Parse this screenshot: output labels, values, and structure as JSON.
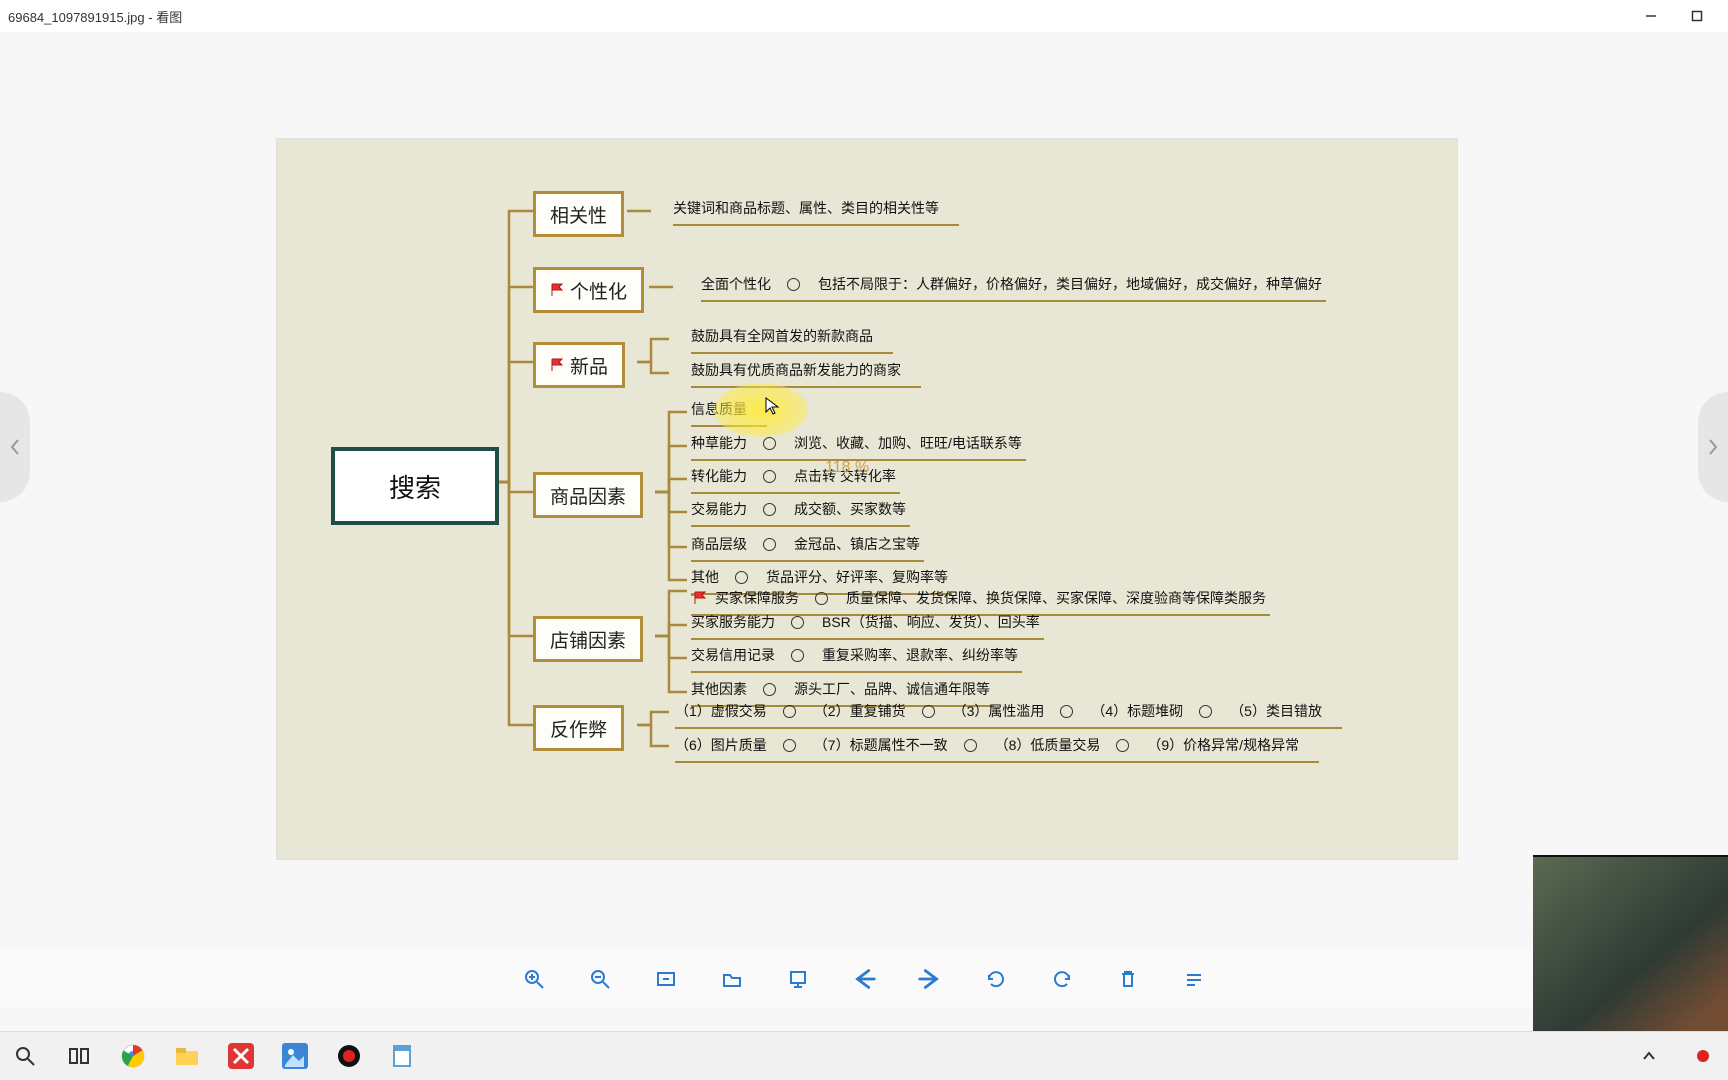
{
  "window": {
    "title": "69684_1097891915.jpg - 看图"
  },
  "watermark": "118 %",
  "root": "搜索",
  "nodes": {
    "n1": "相关性",
    "n2": "个性化",
    "n3": "新品",
    "n4": "商品因素",
    "n5": "店铺因素",
    "n6": "反作弊"
  },
  "n1": {
    "a": "关键词和商品标题、属性、类目的相关性等"
  },
  "n2": {
    "a_l": "全面个性化",
    "a_r": "包括不局限于：人群偏好，价格偏好，类目偏好，地域偏好，成交偏好，种草偏好"
  },
  "n3": {
    "a": "鼓励具有全网首发的新款商品",
    "b": "鼓励具有优质商品新发能力的商家"
  },
  "n4": {
    "a": "信息质量",
    "b_l": "种草能力",
    "b_r": "浏览、收藏、加购、旺旺/电话联系等",
    "c_l": "转化能力",
    "c_r": "点击转       交转化率",
    "d_l": "交易能力",
    "d_r": "成交额、买家数等",
    "e_l": "商品层级",
    "e_r": "金冠品、镇店之宝等",
    "f_l": "其他",
    "f_r": "货品评分、好评率、复购率等"
  },
  "n5": {
    "a_l": "买家保障服务",
    "a_r": "质量保障、发货保障、换货保障、买家保障、深度验商等保障类服务",
    "b_l": "买家服务能力",
    "b_r": "BSR（货描、响应、发货）、回头率",
    "c_l": "交易信用记录",
    "c_r": "重复采购率、退款率、纠纷率等",
    "d_l": "其他因素",
    "d_r": "源头工厂、品牌、诚信通年限等"
  },
  "n6": {
    "r1a": "（1）虚假交易",
    "r1b": "（2）重复铺货",
    "r1c": "（3）属性滥用",
    "r1d": "（4）标题堆砌",
    "r1e": "（5）类目错放",
    "r2a": "（6）图片质量",
    "r2b": "（7）标题属性不一致",
    "r2c": "（8）低质量交易",
    "r2d": "（9）价格异常/规格异常"
  }
}
